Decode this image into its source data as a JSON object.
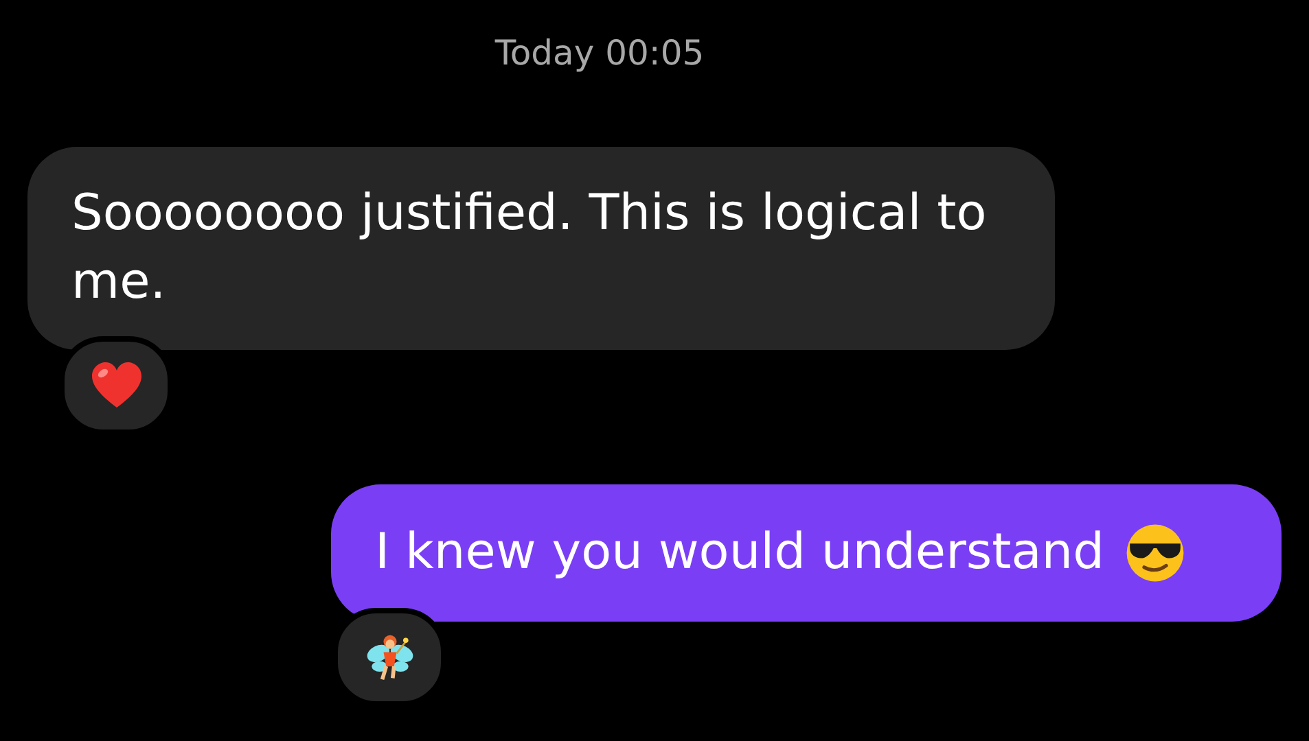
{
  "timestamp": "Today 00:05",
  "messages": [
    {
      "kind": "incoming",
      "text": "Soooooooo justified. This is logical to me.",
      "reaction": {
        "kind": "heart"
      }
    },
    {
      "kind": "outgoing",
      "text": "I knew you would understand",
      "emoji": {
        "kind": "sunglasses"
      },
      "reaction": {
        "kind": "fairy"
      }
    }
  ]
}
